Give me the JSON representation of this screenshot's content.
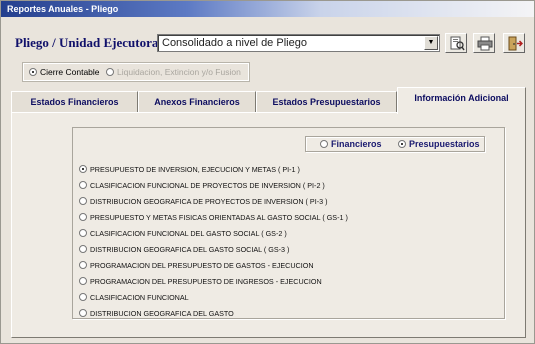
{
  "window": {
    "title": "Reportes Anuales - Pliego"
  },
  "header": {
    "label": "Pliego / Unidad Ejecutora :",
    "combo_value": "Consolidado a nivel de Pliego"
  },
  "mode": {
    "options": [
      {
        "label": "Cierre Contable",
        "selected": true,
        "enabled": true
      },
      {
        "label": "Liquidacion, Extincion y/o Fusion",
        "selected": false,
        "enabled": false
      }
    ]
  },
  "tabs": [
    {
      "label": "Estados Financieros",
      "active": false
    },
    {
      "label": "Anexos Financieros",
      "active": false
    },
    {
      "label": "Estados Presupuestarios",
      "active": false
    },
    {
      "label": "Información Adicional",
      "active": true
    }
  ],
  "report_type": {
    "options": [
      {
        "label": "Financieros",
        "selected": false
      },
      {
        "label": "Presupuestarios",
        "selected": true
      }
    ]
  },
  "reports": [
    {
      "label": "PRESUPUESTO DE INVERSION, EJECUCION Y METAS ( PI-1 )",
      "selected": true
    },
    {
      "label": "CLASIFICACION FUNCIONAL DE PROYECTOS DE INVERSION ( PI-2 )",
      "selected": false
    },
    {
      "label": "DISTRIBUCION GEOGRAFICA DE PROYECTOS DE INVERSION ( PI-3 )",
      "selected": false
    },
    {
      "label": "PRESUPUESTO Y METAS FISICAS ORIENTADAS AL GASTO SOCIAL ( GS-1 )",
      "selected": false
    },
    {
      "label": "CLASIFICACION FUNCIONAL DEL GASTO SOCIAL ( GS-2 )",
      "selected": false
    },
    {
      "label": "DISTRIBUCION GEOGRAFICA DEL GASTO SOCIAL ( GS-3 )",
      "selected": false
    },
    {
      "label": "PROGRAMACION DEL PRESUPUESTO DE GASTOS - EJECUCION",
      "selected": false
    },
    {
      "label": "PROGRAMACION DEL PRESUPUESTO DE INGRESOS - EJECUCION",
      "selected": false
    },
    {
      "label": "CLASIFICACION FUNCIONAL",
      "selected": false
    },
    {
      "label": "DISTRIBUCION GEOGRAFICA DEL GASTO",
      "selected": false
    }
  ],
  "toolbar": {
    "icons": [
      "print-preview-icon",
      "printer-icon",
      "exit-icon"
    ]
  },
  "colors": {
    "titlebar": "#243f8e",
    "label_blue": "#10106a",
    "window_bg": "#e9e4dc"
  }
}
